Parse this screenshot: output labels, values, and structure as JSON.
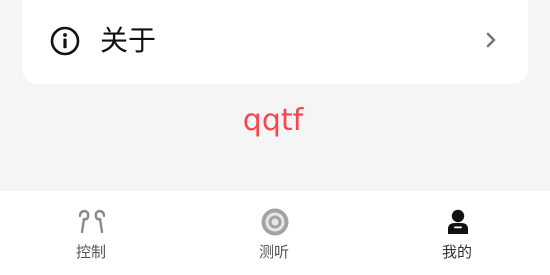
{
  "settings": {
    "about_label": "关于"
  },
  "brand": {
    "text": "qqtf",
    "color": "#f5474f"
  },
  "tabbar": {
    "tabs": [
      {
        "id": "control",
        "label": "控制",
        "icon": "earbuds-icon",
        "active": false
      },
      {
        "id": "listen",
        "label": "测听",
        "icon": "hearing-test-icon",
        "active": false
      },
      {
        "id": "mine",
        "label": "我的",
        "icon": "user-icon",
        "active": true
      }
    ]
  },
  "colors": {
    "background": "#f5f5f5",
    "card": "#ffffff",
    "accent": "#f5474f",
    "inactive_icon": "#8a8a8a",
    "active_icon": "#111111"
  }
}
